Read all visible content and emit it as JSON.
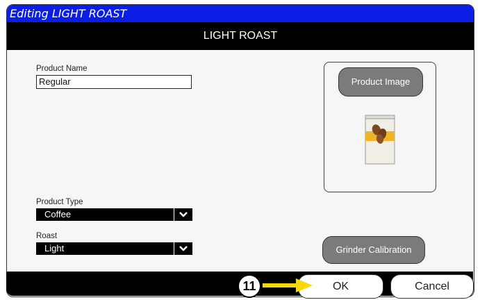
{
  "window": {
    "title": "Editing LIGHT ROAST"
  },
  "header": {
    "title": "LIGHT ROAST"
  },
  "form": {
    "product_name_label": "Product Name",
    "product_name_value": "Regular",
    "product_type_label": "Product Type",
    "product_type_value": "Coffee",
    "roast_label": "Roast",
    "roast_value": "Light"
  },
  "image_panel": {
    "product_image_button": "Product Image",
    "image_icon": "coffee-bag-icon"
  },
  "buttons": {
    "grinder_calibration": "Grinder Calibration",
    "ok": "OK",
    "cancel": "Cancel"
  },
  "annotation": {
    "callout_number": "11",
    "arrow_color": "#f5d90a"
  },
  "colors": {
    "titlebar": "#0c1ee6",
    "header": "#000000",
    "button_gray": "#7b7b7b"
  }
}
